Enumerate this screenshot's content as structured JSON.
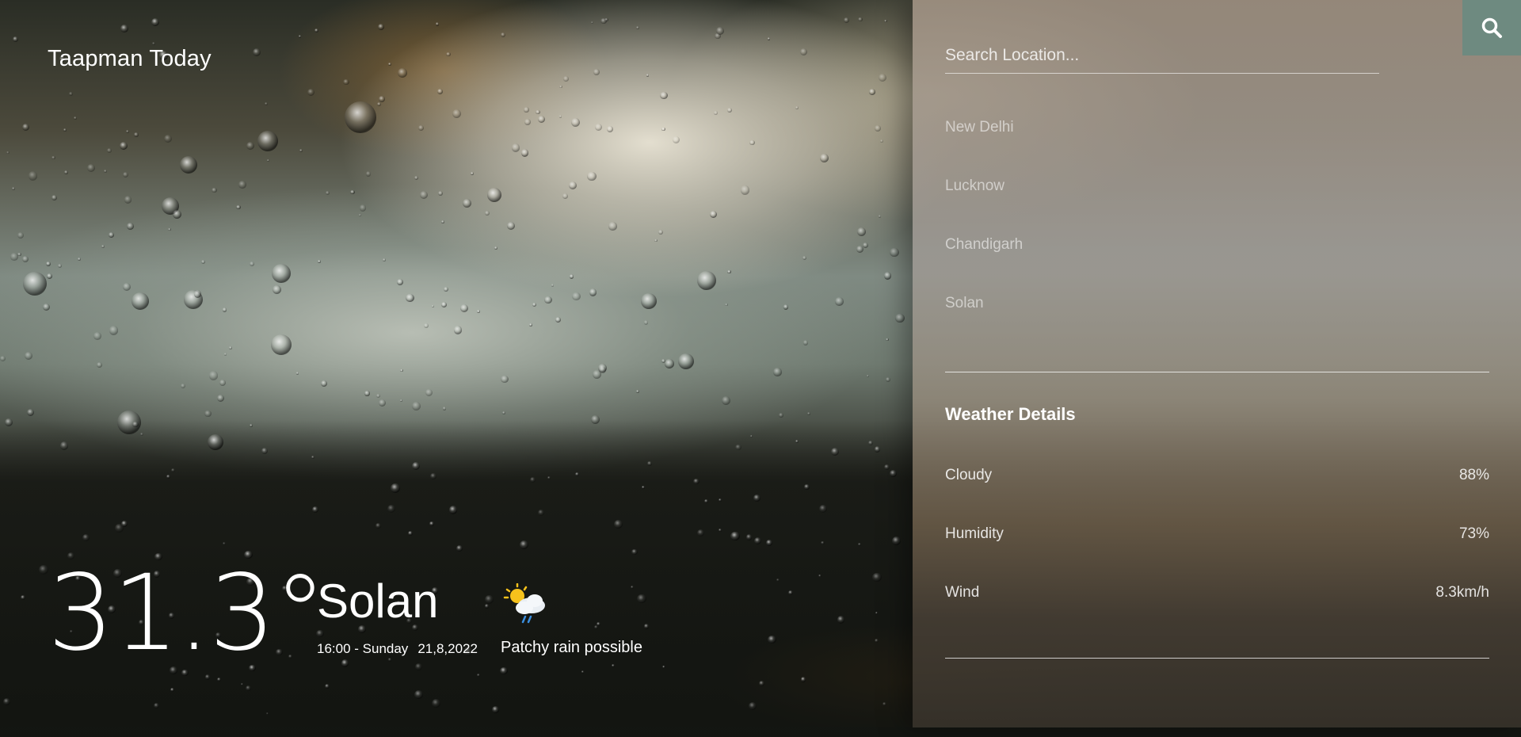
{
  "app": {
    "brand": "Taapman Today"
  },
  "current": {
    "temperature": "31.3°",
    "city": "Solan",
    "time_day": "16:00 - Sunday",
    "date": "21,8,2022",
    "condition": "Patchy rain possible",
    "condition_icon": "cloud-sun-rain-icon"
  },
  "search": {
    "placeholder": "Search Location...",
    "value": "",
    "button_icon": "search-icon"
  },
  "locations": [
    "New Delhi",
    "Lucknow",
    "Chandigarh",
    "Solan"
  ],
  "details": {
    "title": "Weather Details",
    "rows": [
      {
        "label": "Cloudy",
        "value": "88%"
      },
      {
        "label": "Humidity",
        "value": "73%"
      },
      {
        "label": "Wind",
        "value": "8.3km/h"
      }
    ]
  },
  "colors": {
    "search_button": "#6e8a80",
    "text": "#ffffff"
  }
}
